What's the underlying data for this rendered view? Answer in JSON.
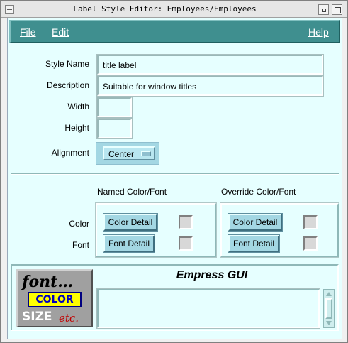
{
  "window": {
    "title": "Label Style Editor: Employees/Employees",
    "minimize_glyph": "▫",
    "maximize_glyph": "□"
  },
  "menu": {
    "file": "File",
    "edit": "Edit",
    "help": "Help"
  },
  "form": {
    "style_name_label": "Style Name",
    "style_name_value": "title label",
    "description_label": "Description",
    "description_value": "Suitable for window titles",
    "width_label": "Width",
    "width_value": "",
    "height_label": "Height",
    "height_value": "",
    "alignment_label": "Alignment",
    "alignment_value": "Center"
  },
  "groups": {
    "named_title": "Named Color/Font",
    "override_title": "Override Color/Font",
    "color_label": "Color",
    "font_label": "Font",
    "color_detail": "Color Detail",
    "font_detail": "Font Detail"
  },
  "preview": {
    "title": "Empress GUI",
    "text": "",
    "logo_font": "font…",
    "logo_color": "COLOR",
    "logo_size": "SIZE",
    "logo_etc": "etc."
  },
  "colors": {
    "background": "#e6ffff",
    "menubar": "#3f8f8f",
    "button": "#a3d7e3",
    "logo_yellow": "#ffff00",
    "logo_red": "#c00000"
  }
}
